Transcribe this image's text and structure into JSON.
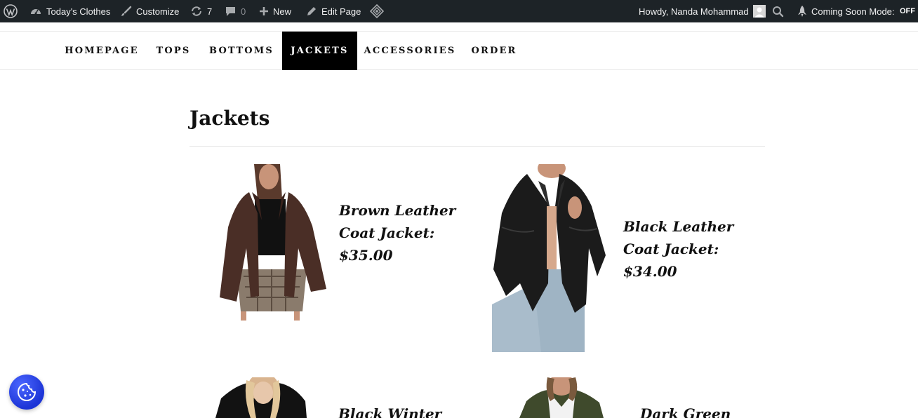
{
  "adminbar": {
    "site_name": "Today's Clothes",
    "customize": "Customize",
    "updates_count": "7",
    "comments_count": "0",
    "new": "New",
    "edit_page": "Edit Page",
    "howdy": "Howdy, Nanda Mohammad",
    "coming_soon": "Coming Soon Mode:",
    "coming_soon_state": "OFF"
  },
  "nav": {
    "items": [
      {
        "label": "HOMEPAGE",
        "active": false
      },
      {
        "label": "TOPS",
        "active": false
      },
      {
        "label": "BOTTOMS",
        "active": false
      },
      {
        "label": "JACKETS",
        "active": true
      },
      {
        "label": "ACCESSORIES",
        "active": false
      },
      {
        "label": "ORDER",
        "active": false
      }
    ]
  },
  "page": {
    "title": "Jackets"
  },
  "products": [
    {
      "name_line1": "Brown Leather",
      "name_line2": "Coat Jacket:",
      "price": "$35.00",
      "jacket_color": "#4a2e26"
    },
    {
      "name_line1": "Black Leather",
      "name_line2": "Coat Jacket:",
      "price": "$34.00",
      "jacket_color": "#1b1b1b"
    },
    {
      "name_line1": "Black Winter",
      "jacket_color": "#121212"
    },
    {
      "name_line1": "Dark Green",
      "jacket_color": "#3f4a2c"
    }
  ],
  "colors": {
    "adminbar_bg": "#1d2327",
    "nav_active_bg": "#000000",
    "cookie_button": "#2a45ee"
  }
}
